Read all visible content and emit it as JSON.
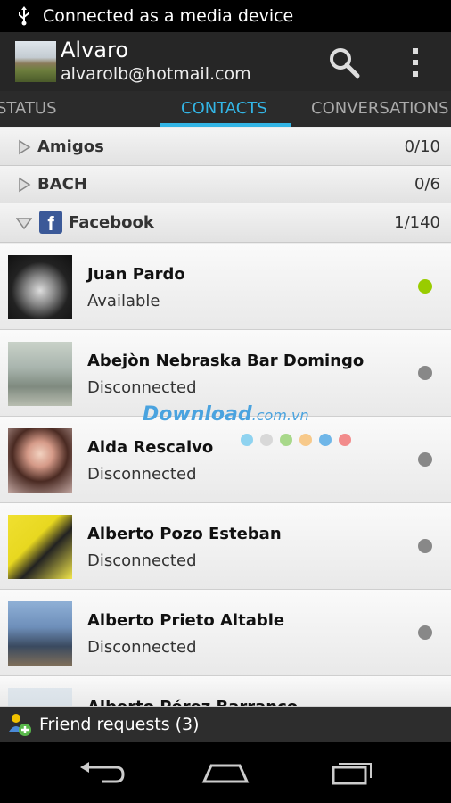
{
  "status_bar": {
    "text": "Connected as a media device",
    "icon": "usb-icon"
  },
  "account": {
    "name": "Alvaro",
    "email": "alvarolb@hotmail.com"
  },
  "action_icons": [
    "search-icon",
    "overflow-menu-icon"
  ],
  "tabs": [
    {
      "label": "STATUS",
      "selected": false
    },
    {
      "label": "CONTACTS",
      "selected": true
    },
    {
      "label": "CONVERSATIONS",
      "selected": false
    }
  ],
  "groups": [
    {
      "name": "Amigos",
      "count": "0/10",
      "expanded": false
    },
    {
      "name": "BACH",
      "count": "0/6",
      "expanded": false
    },
    {
      "name": "Facebook",
      "count": "1/140",
      "expanded": true
    }
  ],
  "contacts": [
    {
      "name": "Juan Pardo",
      "status": "Available",
      "online": true
    },
    {
      "name": "Abejòn Nebraska Bar Domingo",
      "status": "Disconnected",
      "online": false
    },
    {
      "name": "Aida Rescalvo",
      "status": "Disconnected",
      "online": false
    },
    {
      "name": "Alberto Pozo Esteban",
      "status": "Disconnected",
      "online": false
    },
    {
      "name": "Alberto Prieto Altable",
      "status": "Disconnected",
      "online": false
    },
    {
      "name": "Alberto Pérez Barranco",
      "status": "",
      "online": false
    }
  ],
  "watermark": {
    "text": "Download",
    "suffix": ".com.vn"
  },
  "footer": {
    "friend_requests": "Friend requests (3)"
  },
  "colors": {
    "accent": "#33b5e5",
    "online": "#99cc00",
    "offline": "#888888",
    "facebook": "#3b5998"
  }
}
